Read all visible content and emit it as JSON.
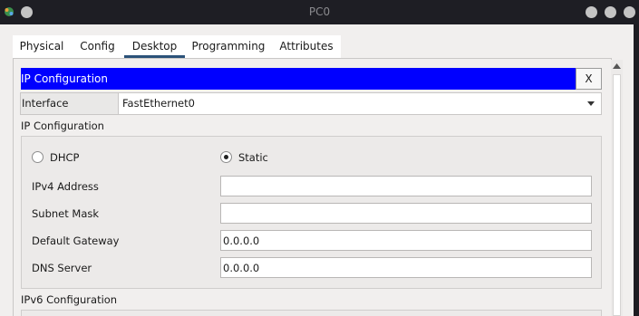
{
  "window": {
    "title": "PC0"
  },
  "tabs": [
    {
      "label": "Physical",
      "active": false
    },
    {
      "label": "Config",
      "active": false
    },
    {
      "label": "Desktop",
      "active": true
    },
    {
      "label": "Programming",
      "active": false
    },
    {
      "label": "Attributes",
      "active": false
    }
  ],
  "panel": {
    "header": "IP Configuration",
    "close_label": "X",
    "interface_label": "Interface",
    "interface_value": "FastEthernet0",
    "ipv4_section_label": "IP Configuration",
    "ipv6_section_label": "IPv6 Configuration"
  },
  "mode": {
    "dhcp_label": "DHCP",
    "static_label": "Static",
    "selected": "Static"
  },
  "fields": {
    "ipv4_address": {
      "label": "IPv4 Address",
      "value": ""
    },
    "subnet_mask": {
      "label": "Subnet Mask",
      "value": ""
    },
    "default_gateway": {
      "label": "Default Gateway",
      "value": "0.0.0.0"
    },
    "dns_server": {
      "label": "DNS Server",
      "value": "0.0.0.0"
    }
  },
  "colors": {
    "header_bg": "#0000ff",
    "header_text": "#ffffff",
    "active_tab_underline": "#2b5279"
  },
  "icons": {
    "app": "packet-tracer-icon",
    "window_controls": [
      "minimize-icon",
      "maximize-icon",
      "close-icon"
    ],
    "dropdown": "chevron-down-icon",
    "scroll_up": "arrow-up-icon"
  }
}
